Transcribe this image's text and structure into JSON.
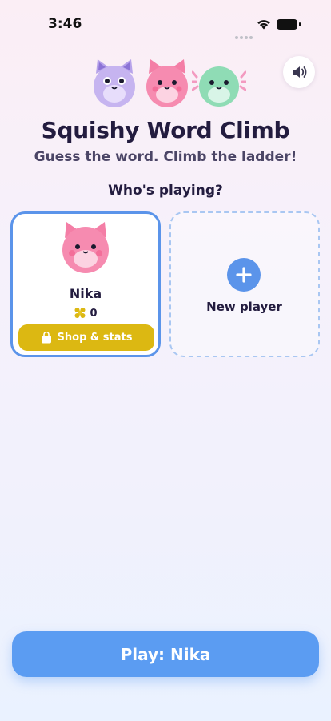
{
  "status_bar": {
    "time": "3:46"
  },
  "header": {
    "title": "Squishy Word Climb",
    "subtitle": "Guess the word. Climb the ladder!",
    "sound_icon": "speaker-icon"
  },
  "players_section": {
    "prompt": "Who's playing?",
    "players": [
      {
        "name": "Nika",
        "coins": "0",
        "shop_label": "Shop & stats",
        "selected": true
      }
    ],
    "new_player_label": "New player"
  },
  "footer": {
    "play_label": "Play: Nika"
  },
  "colors": {
    "accent_blue": "#5b94ea",
    "shop_yellow": "#dcb812",
    "title_text": "#231c3f"
  }
}
